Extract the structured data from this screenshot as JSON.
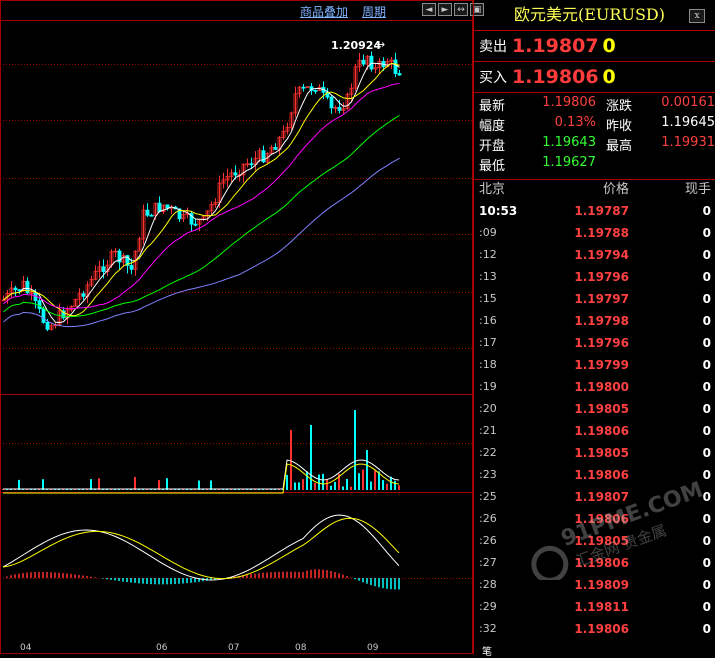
{
  "toolbar": {
    "links": [
      "商品叠加",
      "周期"
    ],
    "nav_buttons": [
      "◄",
      "►",
      "↔",
      "▣"
    ]
  },
  "chart": {
    "peak_label": "1.20924",
    "peak_arrow": "→",
    "x_labels": [
      "04",
      "06",
      "07",
      "08",
      "09"
    ],
    "colors": {
      "up": "#ff3030",
      "down": "#00ffff",
      "ma1": "#ffffff",
      "ma2": "#ffff00",
      "ma3": "#ff00ff",
      "ma4": "#00ff00",
      "ma5": "#8080ff",
      "grid": "#a00000"
    }
  },
  "panel": {
    "title": "欧元美元(EURUSD)",
    "close_icon": "x",
    "sell_label": "卖出",
    "sell_price": "1.19807",
    "sell_vol": "0",
    "buy_label": "买入",
    "buy_price": "1.19806",
    "buy_vol": "0",
    "stats": [
      {
        "k": "最新",
        "v": "1.19806",
        "vc": "red",
        "k2": "涨跌",
        "v2": "0.00161",
        "v2c": "red"
      },
      {
        "k": "幅度",
        "v": "0.13%",
        "vc": "red",
        "k2": "昨收",
        "v2": "1.19645",
        "v2c": "white"
      },
      {
        "k": "开盘",
        "v": "1.19643",
        "vc": "green",
        "k2": "最高",
        "v2": "1.19931",
        "v2c": "red"
      },
      {
        "k": "最低",
        "v": "1.19627",
        "vc": "green",
        "k2": "",
        "v2": "",
        "v2c": "white"
      }
    ],
    "ticks_header": [
      "北京",
      "价格",
      "现手"
    ],
    "ticks": [
      {
        "t": "10:53",
        "p": "1.19787",
        "q": "0"
      },
      {
        "t": ":09",
        "p": "1.19788",
        "q": "0"
      },
      {
        "t": ":12",
        "p": "1.19794",
        "q": "0"
      },
      {
        "t": ":13",
        "p": "1.19796",
        "q": "0"
      },
      {
        "t": ":15",
        "p": "1.19797",
        "q": "0"
      },
      {
        "t": ":16",
        "p": "1.19798",
        "q": "0"
      },
      {
        "t": ":17",
        "p": "1.19796",
        "q": "0"
      },
      {
        "t": ":18",
        "p": "1.19799",
        "q": "0"
      },
      {
        "t": ":19",
        "p": "1.19800",
        "q": "0"
      },
      {
        "t": ":20",
        "p": "1.19805",
        "q": "0"
      },
      {
        "t": ":21",
        "p": "1.19806",
        "q": "0"
      },
      {
        "t": ":22",
        "p": "1.19805",
        "q": "0"
      },
      {
        "t": ":23",
        "p": "1.19806",
        "q": "0"
      },
      {
        "t": ":25",
        "p": "1.19807",
        "q": "0"
      },
      {
        "t": ":26",
        "p": "1.19806",
        "q": "0"
      },
      {
        "t": ":26",
        "p": "1.19805",
        "q": "0"
      },
      {
        "t": ":27",
        "p": "1.19806",
        "q": "0"
      },
      {
        "t": ":28",
        "p": "1.19809",
        "q": "0"
      },
      {
        "t": ":29",
        "p": "1.19811",
        "q": "0"
      },
      {
        "t": ":32",
        "p": "1.19806",
        "q": "0"
      }
    ],
    "bottom_tab": "笔"
  },
  "watermark": {
    "brand": "91PME.COM",
    "sub": "汇金网 贵金属"
  }
}
